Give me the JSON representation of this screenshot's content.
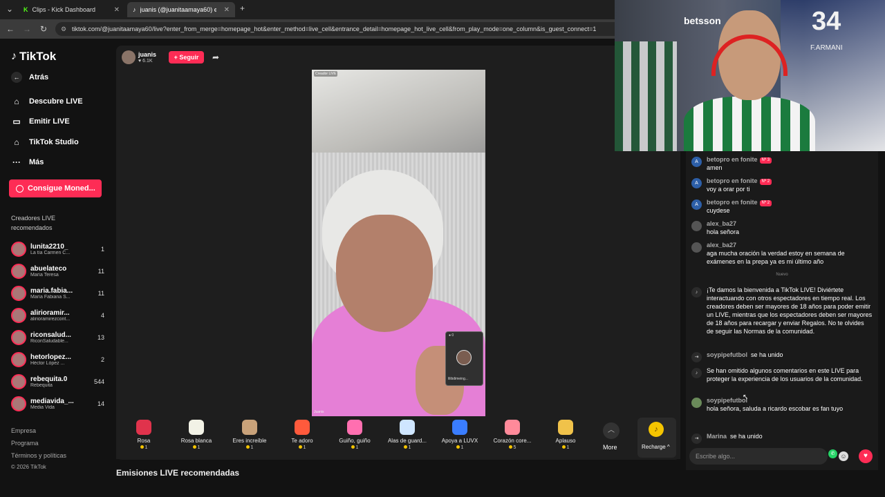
{
  "browser": {
    "tabs": [
      {
        "title": "Clips - Kick Dashboard"
      },
      {
        "title": "juanis (@juanitaamaya60) e"
      }
    ],
    "url": "tiktok.com/@juanitaamaya60/live?enter_from_merge=homepage_hot&enter_method=live_cell&entrance_detail=homepage_hot_live_cell&from_play_mode=one_column&is_guest_connect=1"
  },
  "sidebar": {
    "logo": "TikTok",
    "back": "Atrás",
    "nav": [
      {
        "label": "Descubre LIVE",
        "icon": "home-icon"
      },
      {
        "label": "Emitir LIVE",
        "icon": "video-camera-icon"
      },
      {
        "label": "TikTok Studio",
        "icon": "studio-icon"
      },
      {
        "label": "Más",
        "icon": "more-dots-icon"
      }
    ],
    "coins_button": "Consigue Moned...",
    "creators_title": "Creadores LIVE recomendados",
    "creators": [
      {
        "name": "lunita2210_",
        "sub": "La tía Carmen C...",
        "count": "1"
      },
      {
        "name": "abuelateco",
        "sub": "María Teresa",
        "count": "11"
      },
      {
        "name": "maria.fabia...",
        "sub": "María Fabiana S...",
        "count": "11"
      },
      {
        "name": "alirioramir...",
        "sub": "alirioramirezcont...",
        "count": "4"
      },
      {
        "name": "riconsalud...",
        "sub": "RiconSaludable...",
        "count": "13"
      },
      {
        "name": "hetorlopez...",
        "sub": "Héctor López ...",
        "count": "2"
      },
      {
        "name": "rebequita.0",
        "sub": "Rebequita",
        "count": "544"
      },
      {
        "name": "mediavida_...",
        "sub": "Media Vida",
        "count": "14"
      }
    ],
    "footer": [
      "Empresa",
      "Programa",
      "Términos y políticas",
      "© 2026 TikTok"
    ]
  },
  "stream": {
    "host_name": "juanis",
    "likes": "6.1K",
    "follow": "+ Seguir",
    "video_tag": "Creador LIVE",
    "video_name": "Juanis",
    "guest_name": "lilibdimeing...",
    "guest_count": "0"
  },
  "gifts": [
    {
      "name": "Rosa",
      "price": "1",
      "color": "#e0334c"
    },
    {
      "name": "Rosa blanca",
      "price": "1",
      "color": "#f2f2e6"
    },
    {
      "name": "Eres increíble",
      "price": "1",
      "color": "#c9a27a"
    },
    {
      "name": "Te adoro",
      "price": "1",
      "color": "#ff5a3c"
    },
    {
      "name": "Guiño, guiño",
      "price": "1",
      "color": "#ff6fb0"
    },
    {
      "name": "Alas de guard...",
      "price": "1",
      "color": "#cfe6ff"
    },
    {
      "name": "Apoya a LUVX",
      "price": "1",
      "color": "#3a7dff"
    },
    {
      "name": "Corazón core...",
      "price": "5",
      "color": "#ff8a9a"
    },
    {
      "name": "Aplauso",
      "price": "1",
      "color": "#f0c24a"
    }
  ],
  "more_label": "More",
  "recharge_label": "Recharge",
  "section_title": "Emisiones LIVE recomendadas",
  "webcam": {
    "number": "34",
    "name": "F.ARMANI",
    "brand": "betsson"
  },
  "chat": {
    "messages": [
      {
        "user": "betopro en fonite",
        "badge": "Nº 3",
        "text": "amen",
        "avatar": "A"
      },
      {
        "user": "betopro en fonite",
        "badge": "Nº 2",
        "text": "voy a orar por ti",
        "avatar": "A"
      },
      {
        "user": "betopro en fonite",
        "badge": "Nº 2",
        "text": "cuydese",
        "avatar": "A"
      },
      {
        "user": "alex_ba27",
        "badge": "",
        "text": "hola señora",
        "avatar": ""
      },
      {
        "user": "alex_ba27",
        "badge": "",
        "text": "aga mucha oración la verdad estoy en semana de exámenes en la prepa ya es mi último año",
        "avatar": ""
      }
    ],
    "new_divider": "Nuevo",
    "system_welcome": "¡Te damos la bienvenida a TikTok LIVE! Diviértete interactuando con otros espectadores en tiempo real. Los creadores deben ser mayores de 18 años para poder emitir un LIVE, mientras que los espectadores deben ser mayores de 18 años para recargar y enviar Regalos. No te olvides de seguir las Normas de la comunidad.",
    "join1_user": "soypipefutbol",
    "join1_text": "se ha unido",
    "system_omitted": "Se han omitido algunos comentarios en este LIVE para proteger la experiencia de los usuarios de la comunidad.",
    "last_user": "soypipefutbol",
    "last_text": "hola señora, saluda a ricardo escobar es fan tuyo",
    "join2_user": "Marina",
    "join2_text": "se ha unido",
    "input_placeholder": "Escribe algo..."
  }
}
